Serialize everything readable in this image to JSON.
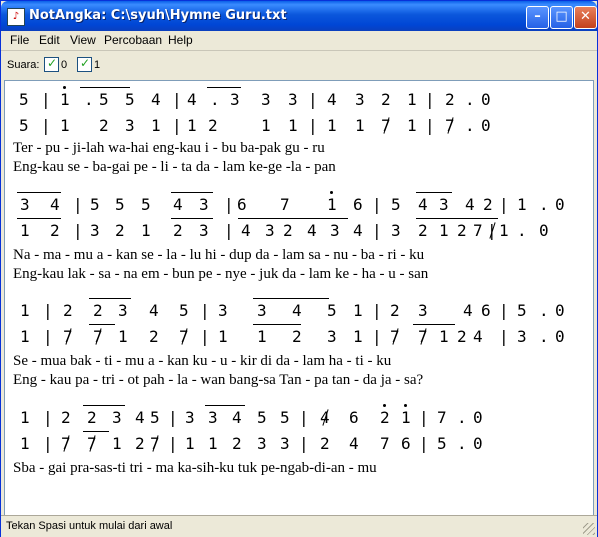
{
  "window": {
    "title": "NotAngka: C:\\syuh\\Hymne Guru.txt"
  },
  "menu": [
    "File",
    "Edit",
    "View",
    "Percobaan",
    "Help"
  ],
  "toolbar": {
    "label": "Suara:",
    "voices": [
      "0",
      "1"
    ]
  },
  "score": [
    {
      "notes": [
        [
          "5",
          "|",
          "1",
          ".",
          " 5",
          "5",
          "4",
          "|",
          "4",
          ".",
          "3",
          "3",
          "3",
          "|",
          "4",
          "3",
          "2",
          "1",
          "|",
          "2",
          ".",
          "0"
        ],
        [
          "5",
          "|",
          "1",
          "2",
          "3",
          "1",
          "|",
          "1",
          "2",
          "1",
          "1",
          "|",
          "1",
          "1",
          "7",
          "1",
          "|",
          "7",
          ".",
          "0"
        ]
      ],
      "lyrics": [
        "Ter - pu  -  ji-lah wa-hai    eng-kau  i  -  bu  ba-pak gu - ru",
        "Eng-kau    se - ba-gai   pe  -  li - ta  da - lam ke-ge -la - pan"
      ]
    },
    {
      "notes": [
        [
          "3",
          "4",
          "|",
          "5",
          "5",
          "5",
          "4",
          "3",
          "|",
          "6",
          "7",
          "1",
          "6",
          "|",
          "5",
          "4",
          "3",
          "4",
          "2",
          "|",
          "1",
          ".",
          "0"
        ],
        [
          "1",
          "2",
          "|",
          "3",
          "2",
          "1",
          "2",
          "3",
          "|",
          "4",
          "3",
          "2",
          "4",
          "3",
          "4",
          "|",
          "3",
          "2",
          "1",
          "2",
          "7",
          "|",
          "1",
          ".",
          "0"
        ]
      ],
      "lyrics": [
        "Na - ma - mu  a - kan  se - la - lu      hi - dup da - lam sa - nu - ba - ri - ku",
        "Eng-kau  lak - sa - na  em - bun  pe - nye - juk da - lam ke  -  ha - u - san"
      ]
    },
    {
      "notes": [
        [
          "1",
          "|",
          "2",
          "2",
          "3",
          "4",
          "5",
          "|",
          "3",
          "3",
          "4",
          "5",
          "1",
          "|",
          "2",
          "3",
          "4",
          "6",
          "|",
          "5",
          ".",
          "0"
        ],
        [
          "1",
          "|",
          "7",
          "7",
          "1",
          "2",
          "7",
          "|",
          "1",
          "1",
          "2",
          "3",
          "1",
          "|",
          "7",
          "7",
          "1",
          "2",
          "4",
          "|",
          "3",
          ".",
          "0"
        ]
      ],
      "lyrics": [
        "Se - mua bak - ti - mu    a   -  kan  ku  -  u  - kir   di     da - lam   ha - ti - ku",
        "Eng - kau  pa - tri - ot  pah -  la - wan bang-sa  Tan - pa tan  -  da ja - sa?"
      ]
    },
    {
      "notes": [
        [
          "1",
          "|",
          "2",
          "2",
          "3",
          "4",
          "5",
          "|",
          "3",
          "3",
          "4",
          "5",
          "5",
          "|",
          "4",
          "6",
          "2",
          "1",
          "|",
          "7",
          ".",
          "0"
        ],
        [
          "1",
          "|",
          "7",
          "7",
          "1",
          "2",
          "7",
          "|",
          "1",
          "1",
          "2",
          "3",
          "3",
          "|",
          "2",
          "4",
          "7",
          "6",
          "|",
          "5",
          ".",
          "0"
        ]
      ],
      "lyrics": [
        "Sba - gai pra-sas-ti tri - ma ka-sih-ku tuk   pe-ngab-di-an - mu"
      ]
    }
  ],
  "status": "Tekan Spasi untuk mulai dari awal"
}
